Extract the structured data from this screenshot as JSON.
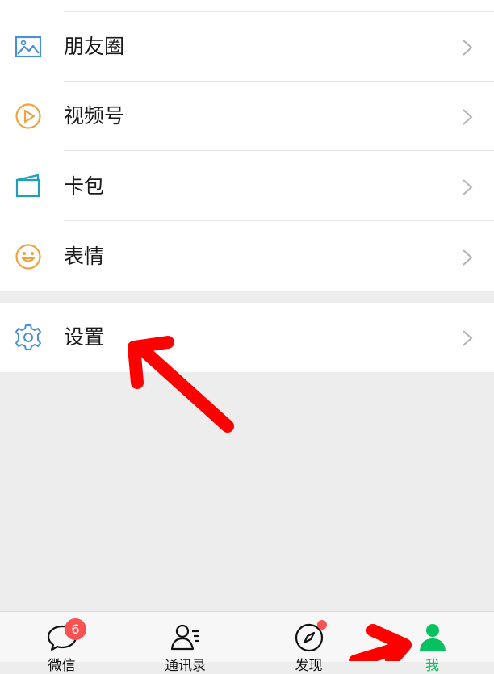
{
  "menu": {
    "items": [
      {
        "label": "朋友圈",
        "icon": "moments-icon"
      },
      {
        "label": "视频号",
        "icon": "channels-play-icon"
      },
      {
        "label": "卡包",
        "icon": "card-wallet-icon"
      },
      {
        "label": "表情",
        "icon": "smiley-emoji-icon"
      }
    ],
    "settings": {
      "label": "设置",
      "icon": "gear-icon"
    }
  },
  "tabbar": {
    "tabs": [
      {
        "label": "微信",
        "icon": "chat-bubble-icon",
        "badge": "6"
      },
      {
        "label": "通讯录",
        "icon": "contacts-icon"
      },
      {
        "label": "发现",
        "icon": "compass-icon",
        "dot": true
      },
      {
        "label": "我",
        "icon": "person-icon",
        "active": true
      }
    ]
  },
  "colors": {
    "accent": "#07c160",
    "badge": "#fa5151",
    "annotation_arrow": "#ff0000",
    "moments_icon": "#4a90d9",
    "channels_icon": "#f0a33a",
    "card_icon": "#20a0b8",
    "emoji_icon": "#f0a33a",
    "settings_icon": "#4a90d9"
  }
}
